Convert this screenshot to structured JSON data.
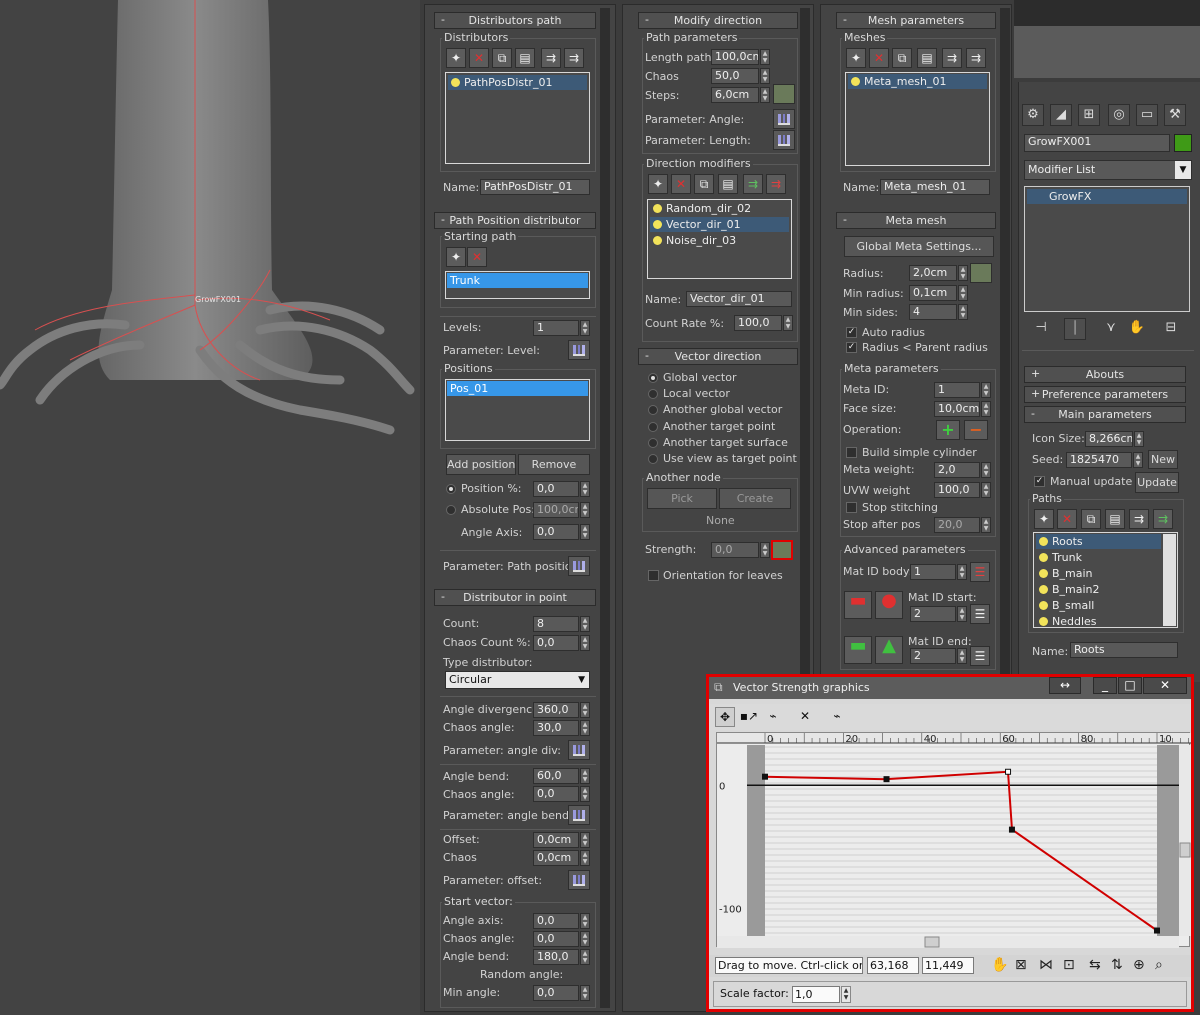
{
  "viewport": {
    "object_label": "GrowFX001"
  },
  "distributors_path": {
    "title": "Distributors path",
    "group_distributors": "Distributors",
    "list": [
      "PathPosDistr_01"
    ],
    "name_label": "Name:",
    "name_value": "PathPosDistr_01"
  },
  "path_position": {
    "title": "Path Position distributor",
    "starting_path": "Starting path",
    "path_list": [
      "Trunk"
    ],
    "levels_label": "Levels:",
    "levels_value": "1",
    "param_level": "Parameter: Level:",
    "positions_group": "Positions",
    "positions_list": [
      "Pos_01"
    ],
    "add_position": "Add position",
    "remove": "Remove",
    "position_pct_label": "Position %:",
    "position_pct_value": "0,0",
    "abs_pos_label": "Absolute Pos:",
    "abs_pos_value": "100,0cm",
    "angle_axis_label": "Angle Axis:",
    "angle_axis_value": "0,0",
    "param_path_position": "Parameter: Path position:"
  },
  "distributor_point": {
    "title": "Distributor in point",
    "count_label": "Count:",
    "count_value": "8",
    "chaos_count_label": "Chaos Count %:",
    "chaos_count_value": "0,0",
    "type_label": "Type distributor:",
    "type_value": "Circular",
    "angle_div_label": "Angle divergence:",
    "angle_div_value": "360,0",
    "chaos_angle_label": "Chaos angle:",
    "chaos_angle_value": "30,0",
    "param_angle_div": "Parameter: angle div:",
    "angle_bend_label": "Angle bend:",
    "angle_bend_value": "60,0",
    "chaos_angle2_label": "Chaos angle:",
    "chaos_angle2_value": "0,0",
    "param_angle_bend": "Parameter: angle bend:",
    "offset_label": "Offset:",
    "offset_value": "0,0cm",
    "chaos_label": "Chaos",
    "chaos_value": "0,0cm",
    "param_offset": "Parameter: offset:",
    "start_vector": "Start vector:",
    "angle_axis_label": "Angle axis:",
    "angle_axis_value": "0,0",
    "chaos_angle3_label": "Chaos angle:",
    "chaos_angle3_value": "0,0",
    "angle_bend2_label": "Angle bend:",
    "angle_bend2_value": "180,0",
    "random_angle": "Random angle:",
    "min_angle_label": "Min angle:",
    "min_angle_value": "0,0"
  },
  "modify_direction": {
    "title": "Modify direction",
    "path_params": "Path parameters",
    "length_label": "Length path:",
    "length_value": "100,0cm",
    "chaos_label": "Chaos",
    "chaos_value": "50,0",
    "steps_label": "Steps:",
    "steps_value": "6,0cm",
    "param_angle": "Parameter: Angle:",
    "param_length": "Parameter: Length:",
    "dir_modifiers": "Direction modifiers",
    "modifiers_list": [
      "Random_dir_02",
      "Vector_dir_01",
      "Noise_dir_03"
    ],
    "name_label": "Name:",
    "name_value": "Vector_dir_01",
    "count_rate_label": "Count Rate %:",
    "count_rate_value": "100,0"
  },
  "vector_direction": {
    "title": "Vector direction",
    "options": [
      "Global vector",
      "Local vector",
      "Another global vector",
      "Another target point",
      "Another target surface",
      "Use view as target point"
    ],
    "another_node": "Another node",
    "pick": "Pick",
    "create": "Create",
    "none": "None",
    "strength_label": "Strength:",
    "strength_value": "0,0",
    "orientation": "Orientation for leaves"
  },
  "mesh_params": {
    "title": "Mesh parameters",
    "meshes": "Meshes",
    "list": [
      "Meta_mesh_01"
    ],
    "name_label": "Name:",
    "name_value": "Meta_mesh_01"
  },
  "meta_mesh": {
    "title": "Meta mesh",
    "global_settings": "Global Meta Settings...",
    "radius_label": "Radius:",
    "radius_value": "2,0cm",
    "min_radius_label": "Min radius:",
    "min_radius_value": "0,1cm",
    "min_sides_label": "Min sides:",
    "min_sides_value": "4",
    "auto_radius": "Auto radius",
    "radius_parent": "Radius < Parent radius",
    "meta_params": "Meta parameters",
    "meta_id_label": "Meta ID:",
    "meta_id_value": "1",
    "face_size_label": "Face size:",
    "face_size_value": "10,0cm",
    "operation_label": "Operation:",
    "build_cylinder": "Build simple cylinder",
    "meta_weight_label": "Meta weight:",
    "meta_weight_value": "2,0",
    "uvw_weight_label": "UVW weight",
    "uvw_weight_value": "100,0",
    "stop_stitching": "Stop stitching",
    "stop_after_label": "Stop after pos",
    "stop_after_value": "20,0",
    "advanced": "Advanced parameters",
    "mat_id_body_label": "Mat ID body:",
    "mat_id_body_value": "1",
    "mat_id_start_label": "Mat ID start:",
    "mat_id_start_value": "2",
    "mat_id_end_label": "Mat ID end:",
    "mat_id_end_value": "2"
  },
  "command_panel": {
    "object_name": "GrowFX001",
    "object_color": "#3f9a17",
    "modifier_list": "Modifier List",
    "stack": [
      "GrowFX"
    ],
    "abouts": "Abouts",
    "preference": "Preference parameters",
    "main_params": "Main parameters",
    "icon_size_label": "Icon Size:",
    "icon_size_value": "8,266cm",
    "seed_label": "Seed:",
    "seed_value": "1825470",
    "new_label": "New",
    "manual_update": "Manual update",
    "update_label": "Update",
    "paths_group": "Paths",
    "paths_list": [
      "Roots",
      "Trunk",
      "B_main",
      "B_main2",
      "B_small",
      "Neddles"
    ],
    "name_label": "Name:",
    "name_value": "Roots"
  },
  "graph_window": {
    "title": "Vector Strength graphics",
    "status_text": "Drag to move. Ctrl-click or dra",
    "coord_x": "63,168",
    "coord_y": "11,449",
    "scale_label": "Scale factor:",
    "scale_value": "1,0"
  },
  "chart_data": {
    "type": "line",
    "x_ticks": [
      "0",
      "20",
      "40",
      "60",
      "80",
      "10"
    ],
    "y_ticks": [
      "0",
      "-100"
    ],
    "xlim": [
      0,
      100
    ],
    "ylim": [
      -120,
      10
    ],
    "points": [
      [
        0,
        7
      ],
      [
        31,
        5
      ],
      [
        62,
        11
      ],
      [
        63,
        -36
      ],
      [
        100,
        -118
      ]
    ],
    "line_color": "#d00000"
  }
}
